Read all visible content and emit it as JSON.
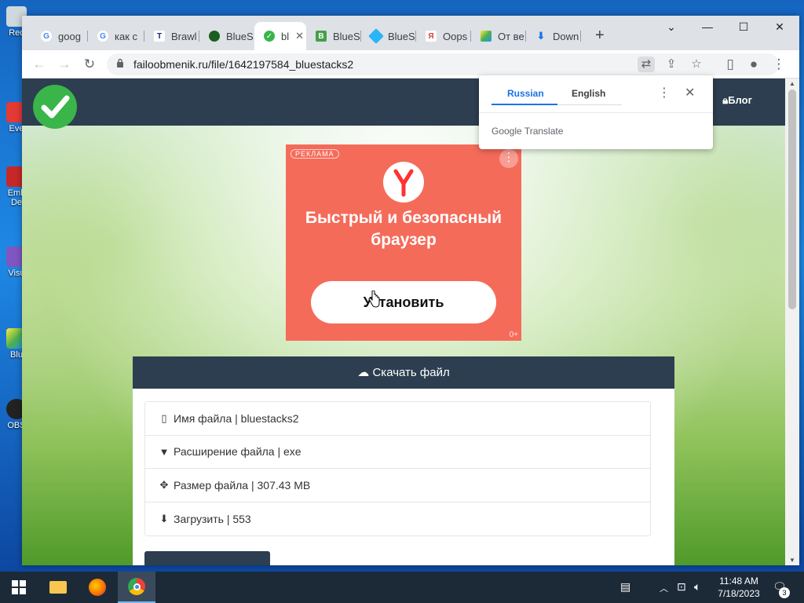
{
  "desktop": {
    "icons": [
      {
        "label": "Rec"
      },
      {
        "label": "Eve"
      },
      {
        "label": "Emb"
      },
      {
        "label": "De"
      },
      {
        "label": "Visu"
      },
      {
        "label": "Blu"
      },
      {
        "label": "OBS"
      }
    ]
  },
  "browser": {
    "tabs": [
      {
        "label": "goog",
        "favicon": "google-icon"
      },
      {
        "label": "как с",
        "favicon": "google-icon"
      },
      {
        "label": "Brawl",
        "favicon": "t-icon"
      },
      {
        "label": "BlueS",
        "favicon": "globe-icon"
      },
      {
        "label": "bl",
        "favicon": "check-icon",
        "active": true
      },
      {
        "label": "BlueS",
        "favicon": "b-icon"
      },
      {
        "label": "BlueS",
        "favicon": "diamond-icon"
      },
      {
        "label": "Oops",
        "favicon": "yandex-icon"
      },
      {
        "label": "От ве",
        "favicon": "bluestacks-icon"
      },
      {
        "label": "Down",
        "favicon": "download-icon"
      }
    ],
    "address": "failoobmenik.ru/file/1642197584_bluestacks2"
  },
  "translate_popup": {
    "lang_source": "Russian",
    "lang_target": "English",
    "brand": "Google Translate"
  },
  "site": {
    "blog_label": "Блог"
  },
  "ad": {
    "badge": "РЕКЛАМА",
    "headline_line1": "Быстрый и безопасный",
    "headline_line2": "браузер",
    "install_label": "Установить",
    "age": "0+"
  },
  "download": {
    "header": "Скачать файл",
    "rows": [
      {
        "text": "Имя файла | bluestacks2",
        "icon": "file-icon"
      },
      {
        "text": "Расширение файла | exe",
        "icon": "filter-icon"
      },
      {
        "text": "Размер файла | 307.43 MB",
        "icon": "crosshair-icon"
      },
      {
        "text": "Загрузить | 553",
        "icon": "download-icon"
      }
    ]
  },
  "taskbar": {
    "time": "11:48 AM",
    "date": "7/18/2023",
    "notifications": "3"
  }
}
